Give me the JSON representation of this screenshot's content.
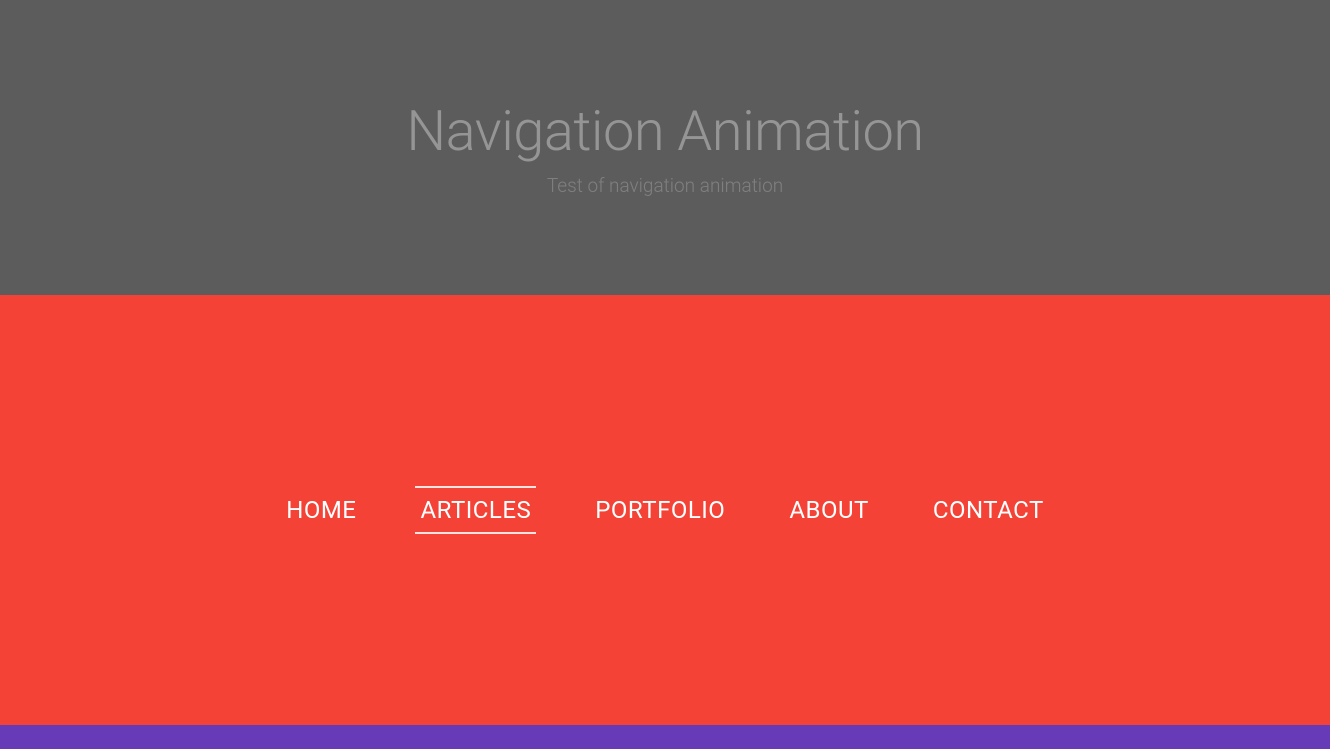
{
  "header": {
    "title": "Navigation Animation",
    "subtitle": "Test of navigation animation"
  },
  "nav": {
    "items": [
      {
        "label": "HOME",
        "active": false
      },
      {
        "label": "ARTICLES",
        "active": true
      },
      {
        "label": "PORTFOLIO",
        "active": false
      },
      {
        "label": "ABOUT",
        "active": false
      },
      {
        "label": "CONTACT",
        "active": false
      }
    ]
  },
  "colors": {
    "header_bg": "#5c5c5c",
    "nav_bg": "#f44336",
    "footer_bg": "#673ab7",
    "nav_text": "#ffffff"
  }
}
